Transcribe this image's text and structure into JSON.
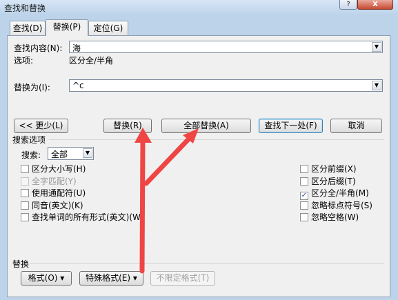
{
  "window": {
    "title": "查找和替换",
    "help": "?",
    "close": "X"
  },
  "tabs": [
    {
      "label": "查找(D)"
    },
    {
      "label": "替换(P)"
    },
    {
      "label": "定位(G)"
    }
  ],
  "find": {
    "label": "查找内容(N):",
    "value": "海"
  },
  "options": {
    "label": "选项:",
    "value": "区分全/半角"
  },
  "replace": {
    "label": "替换为(I):",
    "value": "^c"
  },
  "buttons": {
    "less": "<< 更少(L)",
    "replace": "替换(R)",
    "replace_all": "全部替换(A)",
    "find_next": "查找下一处(F)",
    "cancel": "取消"
  },
  "search_options": {
    "heading": "搜索选项",
    "search_label": "搜索:",
    "search_value": "全部",
    "left": [
      {
        "label": "区分大小写(H)",
        "checked": false,
        "disabled": false
      },
      {
        "label": "全字匹配(Y)",
        "checked": false,
        "disabled": true
      },
      {
        "label": "使用通配符(U)",
        "checked": false,
        "disabled": false
      },
      {
        "label": "同音(英文)(K)",
        "checked": false,
        "disabled": false
      },
      {
        "label": "查找单词的所有形式(英文)(W)",
        "checked": false,
        "disabled": false
      }
    ],
    "right": [
      {
        "label": "区分前缀(X)",
        "checked": false,
        "disabled": false
      },
      {
        "label": "区分后缀(T)",
        "checked": false,
        "disabled": false
      },
      {
        "label": "区分全/半角(M)",
        "checked": true,
        "disabled": false
      },
      {
        "label": "忽略标点符号(S)",
        "checked": false,
        "disabled": false
      },
      {
        "label": "忽略空格(W)",
        "checked": false,
        "disabled": false
      }
    ]
  },
  "replace_section": {
    "heading": "替换",
    "format": "格式(O) ▾",
    "special": "特殊格式(E) ▾",
    "no_format": "不限定格式(T)"
  },
  "colors": {
    "annotation_arrow": "#ef4545"
  }
}
